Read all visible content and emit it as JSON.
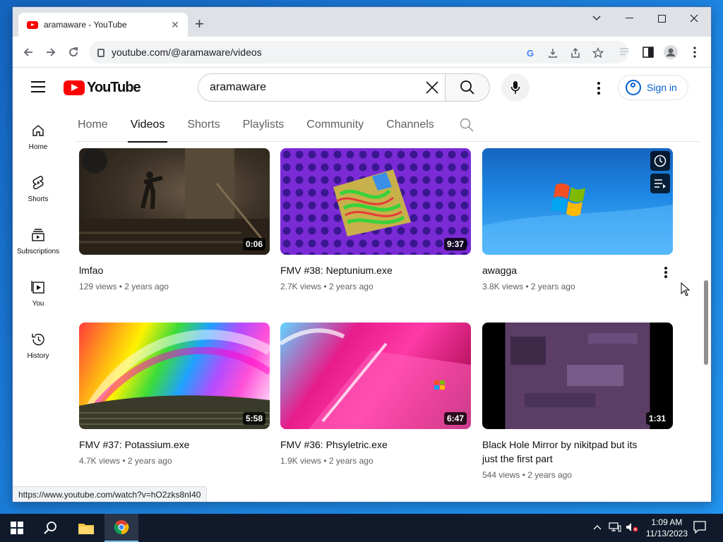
{
  "browser": {
    "tab_title": "aramaware - YouTube",
    "tab_close": "✕",
    "new_tab": "+",
    "url": "youtube.com/@aramaware/videos",
    "status_url": "https://www.youtube.com/watch?v=hO2zks8nI40"
  },
  "youtube": {
    "logo_text": "YouTube",
    "search_query": "aramaware",
    "sign_in": "Sign in",
    "nav": [
      {
        "label": "Home",
        "icon": "home-icon"
      },
      {
        "label": "Shorts",
        "icon": "shorts-icon"
      },
      {
        "label": "Subscriptions",
        "icon": "subscriptions-icon"
      },
      {
        "label": "You",
        "icon": "you-icon"
      },
      {
        "label": "History",
        "icon": "history-icon"
      }
    ],
    "tabs": [
      "Home",
      "Videos",
      "Shorts",
      "Playlists",
      "Community",
      "Channels"
    ],
    "active_tab": "Videos",
    "videos": [
      {
        "title": "lmfao",
        "views": "129 views",
        "age": "2 years ago",
        "duration": "0:06"
      },
      {
        "title": "FMV #38: Neptunium.exe",
        "views": "2.7K views",
        "age": "2 years ago",
        "duration": "9:37"
      },
      {
        "title": "awagga",
        "views": "3.8K views",
        "age": "2 years ago",
        "duration": ""
      },
      {
        "title": "FMV #37: Potassium.exe",
        "views": "4.7K views",
        "age": "2 years ago",
        "duration": "5:58"
      },
      {
        "title": "FMV #36: Phsyletric.exe",
        "views": "1.9K views",
        "age": "2 years ago",
        "duration": "6:47"
      },
      {
        "title": "Black Hole Mirror by nikitpad but its just the first part",
        "views": "544 views",
        "age": "2 years ago",
        "duration": "1:31"
      }
    ],
    "meta_separator": "•"
  },
  "taskbar": {
    "time": "1:09 AM",
    "date": "11/13/2023"
  }
}
